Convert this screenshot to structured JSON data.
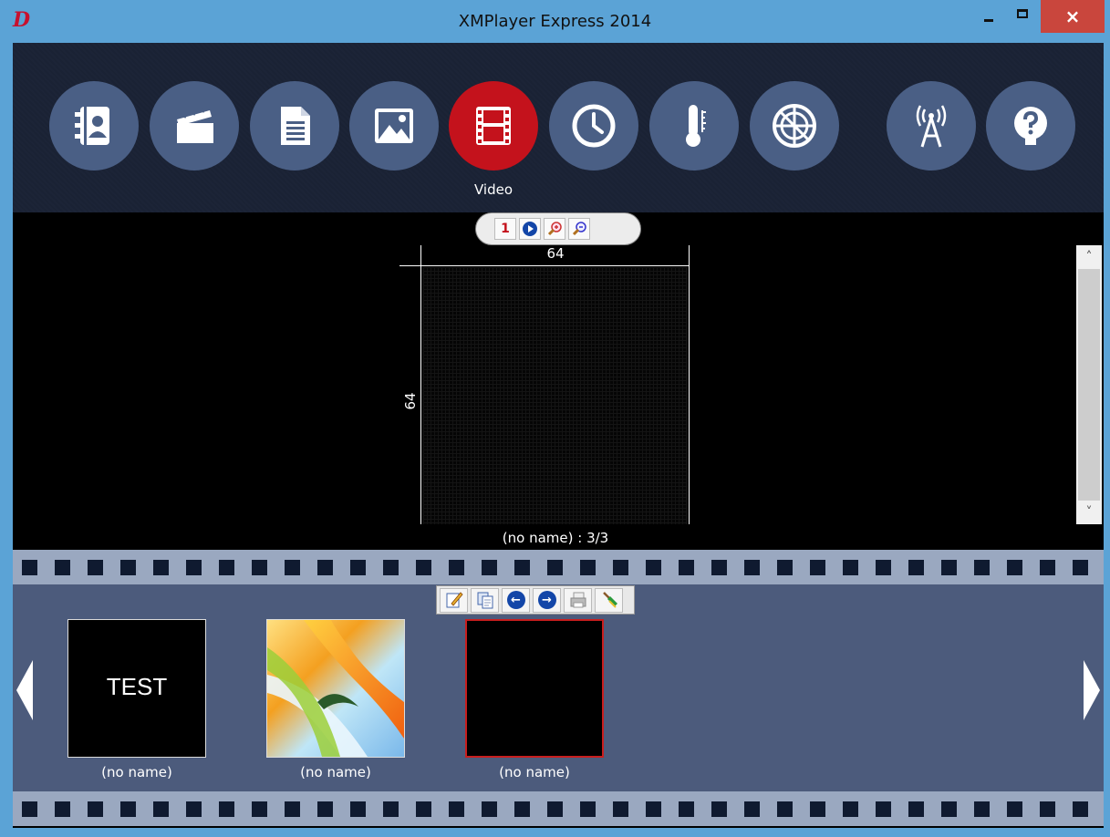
{
  "window": {
    "title": "XMPlayer Express 2014",
    "app_icon": "D",
    "close_glyph": "×"
  },
  "nav": {
    "items": [
      {
        "icon": "contacts-icon"
      },
      {
        "icon": "clapperboard-icon"
      },
      {
        "icon": "document-icon"
      },
      {
        "icon": "image-icon"
      },
      {
        "icon": "film-icon",
        "active": true
      },
      {
        "icon": "clock-icon"
      },
      {
        "icon": "thermometer-icon"
      },
      {
        "icon": "globe-grid-icon"
      },
      {
        "icon": "antenna-icon"
      },
      {
        "icon": "help-icon"
      }
    ],
    "active_label": "Video",
    "active_color": "#c4121c",
    "button_color": "#4a5f85"
  },
  "preview": {
    "toolbar_first": "1",
    "width_label": "64",
    "height_label": "64",
    "caption": "(no name) : 3/3"
  },
  "thumbnails": [
    {
      "name": "(no name)",
      "content": "TEST"
    },
    {
      "name": "(no name)",
      "content": ""
    },
    {
      "name": "(no name)",
      "content": "",
      "selected": true
    }
  ],
  "scroll": {
    "up": "˄",
    "down": "˅"
  },
  "thumbs_toolbar": {
    "prev": "←",
    "next": "→"
  }
}
